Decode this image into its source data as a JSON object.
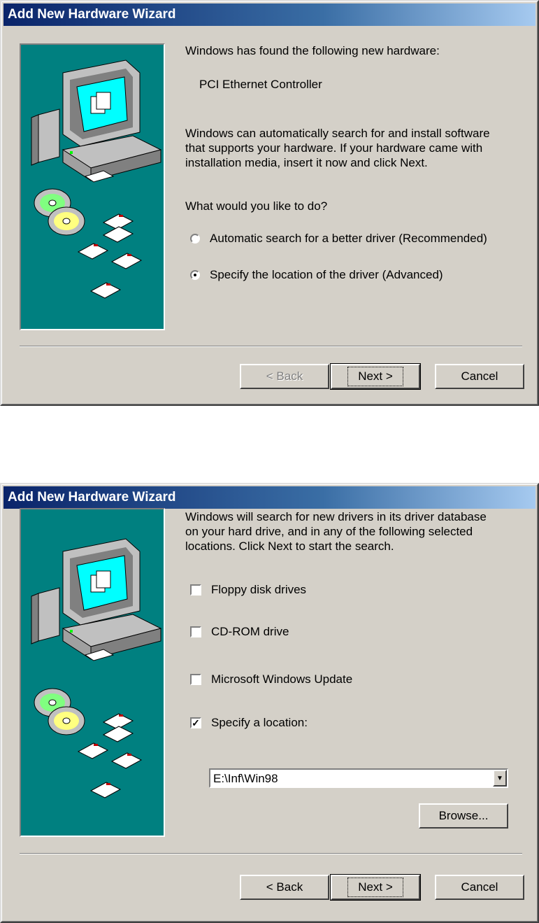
{
  "dialog1": {
    "title": "Add New Hardware Wizard",
    "found_text": "Windows has found the following new hardware:",
    "device_name": "PCI Ethernet Controller",
    "info_lines": [
      "Windows can automatically search for and install software",
      "that supports your hardware. If your hardware came with",
      "installation media, insert it now and click Next."
    ],
    "question": "What would you like to do?",
    "radio_auto": "Automatic search for a better driver (Recommended)",
    "radio_specify": "Specify the location of the driver (Advanced)",
    "selected_option": "specify",
    "back_label": "< Back",
    "next_label": "Next >",
    "cancel_label": "Cancel"
  },
  "dialog2": {
    "title": "Add New Hardware Wizard",
    "info_lines": [
      "Windows will search for new drivers in its driver database",
      "on your hard drive, and in any of the following selected",
      "locations. Click Next to start the search."
    ],
    "chk_floppy": "Floppy disk drives",
    "chk_cdrom": "CD-ROM drive",
    "chk_update": "Microsoft Windows Update",
    "chk_location": "Specify a location:",
    "location_value": "E:\\Inf\\Win98",
    "browse_label": "Browse...",
    "back_label": "< Back",
    "next_label": "Next >",
    "cancel_label": "Cancel",
    "checked": [
      "location"
    ]
  },
  "icons": {
    "computer": "computer-icon",
    "cd": "cd-icon",
    "floppy": "floppy-disk-icon",
    "dropdown": "chevron-down-icon"
  },
  "colors": {
    "title_start": "#0a246a",
    "title_end": "#a6caf0",
    "panel": "#008080",
    "face": "#d4d0c8"
  }
}
